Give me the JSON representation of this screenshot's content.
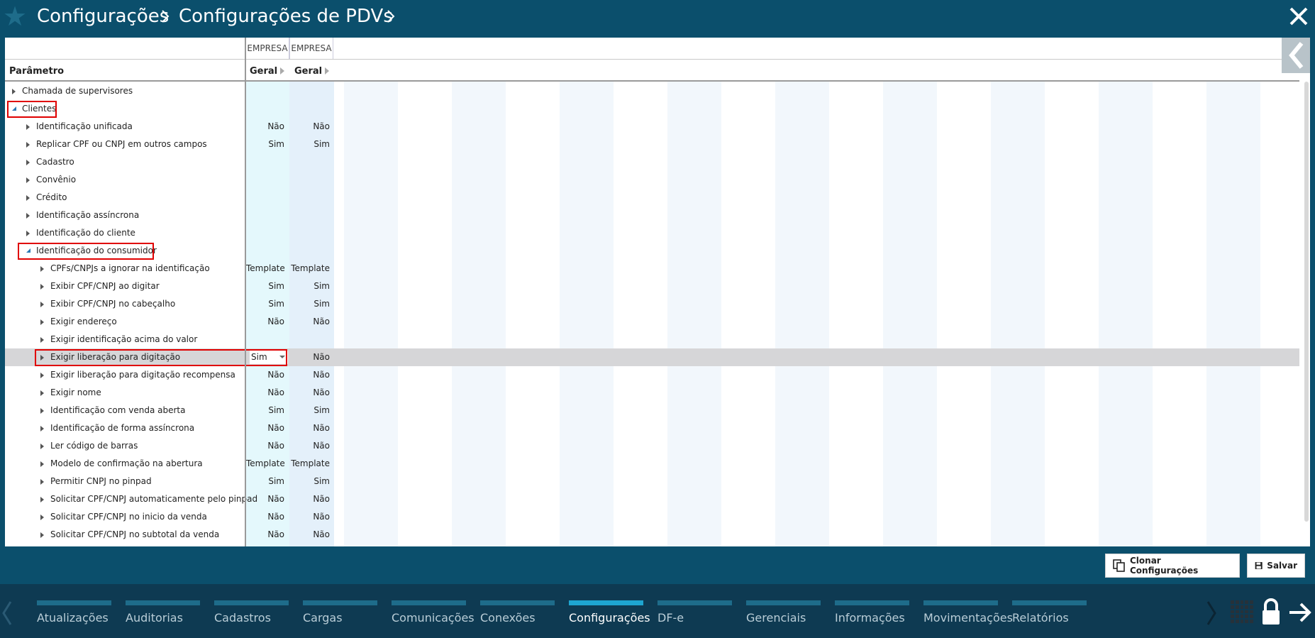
{
  "header": {
    "breadcrumb1": "Configurações",
    "breadcrumb2": "Configurações de PDVs"
  },
  "table": {
    "columns": {
      "parameter": "Parâmetro",
      "col1_group": "EMPRESA",
      "col2_group": "EMPRESA",
      "col1": "Geral",
      "col2": "Geral"
    },
    "rows": [
      {
        "label": "Chamada de supervisores",
        "level": 0,
        "v1": "",
        "v2": ""
      },
      {
        "label": "Clientes",
        "level": 0,
        "v1": "",
        "v2": ""
      },
      {
        "label": "Identificação unificada",
        "level": 1,
        "v1": "Não",
        "v2": "Não"
      },
      {
        "label": "Replicar CPF ou CNPJ em outros campos",
        "level": 1,
        "v1": "Sim",
        "v2": "Sim"
      },
      {
        "label": "Cadastro",
        "level": 1,
        "v1": "",
        "v2": ""
      },
      {
        "label": "Convênio",
        "level": 1,
        "v1": "",
        "v2": ""
      },
      {
        "label": "Crédito",
        "level": 1,
        "v1": "",
        "v2": ""
      },
      {
        "label": "Identificação assíncrona",
        "level": 1,
        "v1": "",
        "v2": ""
      },
      {
        "label": "Identificação do cliente",
        "level": 1,
        "v1": "",
        "v2": ""
      },
      {
        "label": "Identificação do consumidor",
        "level": 1,
        "v1": "",
        "v2": ""
      },
      {
        "label": "CPFs/CNPJs a ignorar na identificação",
        "level": 2,
        "v1": "Template",
        "v2": "Template"
      },
      {
        "label": "Exibir CPF/CNPJ ao digitar",
        "level": 2,
        "v1": "Sim",
        "v2": "Sim"
      },
      {
        "label": "Exibir CPF/CNPJ no cabeçalho",
        "level": 2,
        "v1": "Sim",
        "v2": "Sim"
      },
      {
        "label": "Exigir endereço",
        "level": 2,
        "v1": "Não",
        "v2": "Não"
      },
      {
        "label": "Exigir identificação acima do valor",
        "level": 2,
        "v1": "",
        "v2": ""
      },
      {
        "label": "Exigir liberação para digitação",
        "level": 2,
        "v1": "Sim",
        "v2": "Não"
      },
      {
        "label": "Exigir liberação para digitação recompensa",
        "level": 2,
        "v1": "Não",
        "v2": "Não"
      },
      {
        "label": "Exigir nome",
        "level": 2,
        "v1": "Não",
        "v2": "Não"
      },
      {
        "label": "Identificação com venda aberta",
        "level": 2,
        "v1": "Sim",
        "v2": "Sim"
      },
      {
        "label": "Identificação de forma assíncrona",
        "level": 2,
        "v1": "Não",
        "v2": "Não"
      },
      {
        "label": "Ler código de barras",
        "level": 2,
        "v1": "Não",
        "v2": "Não"
      },
      {
        "label": "Modelo de confirmação na abertura",
        "level": 2,
        "v1": "Template",
        "v2": "Template"
      },
      {
        "label": "Permitir CNPJ no pinpad",
        "level": 2,
        "v1": "Sim",
        "v2": "Sim"
      },
      {
        "label": "Solicitar CPF/CNPJ automaticamente pelo pinpad",
        "level": 2,
        "v1": "Não",
        "v2": "Não"
      },
      {
        "label": "Solicitar CPF/CNPJ no inicio da venda",
        "level": 2,
        "v1": "Não",
        "v2": "Não"
      },
      {
        "label": "Solicitar CPF/CNPJ no subtotal da venda",
        "level": 2,
        "v1": "Não",
        "v2": "Não"
      }
    ]
  },
  "actions": {
    "clone": "Clonar Configurações",
    "save": "Salvar"
  },
  "nav": [
    {
      "label": "Atualizações",
      "active": false
    },
    {
      "label": "Auditorias",
      "active": false
    },
    {
      "label": "Cadastros",
      "active": false
    },
    {
      "label": "Cargas",
      "active": false
    },
    {
      "label": "Comunicações",
      "active": false
    },
    {
      "label": "Conexões",
      "active": false
    },
    {
      "label": "Configurações",
      "active": true
    },
    {
      "label": "DF-e",
      "active": false
    },
    {
      "label": "Gerenciais",
      "active": false
    },
    {
      "label": "Informações",
      "active": false
    },
    {
      "label": "Movimentações",
      "active": false
    },
    {
      "label": "Relatórios",
      "active": false
    }
  ],
  "colors": {
    "header_bg": "#0b4f6c",
    "nav_bg": "#0e3a52",
    "nav_active": "#1ea5d0",
    "highlight_box": "#e00000",
    "selected_row": "#d6d6d8"
  }
}
